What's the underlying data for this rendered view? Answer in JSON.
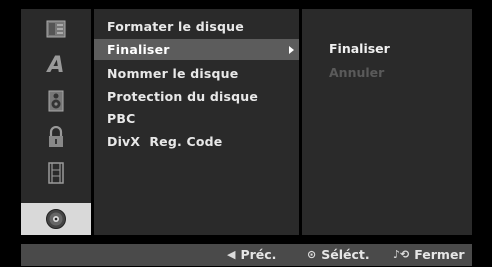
{
  "sidebar": {
    "icons": [
      {
        "name": "disc-menu-icon"
      },
      {
        "name": "language-icon",
        "glyph": "A"
      },
      {
        "name": "audio-speaker-icon"
      },
      {
        "name": "lock-icon"
      },
      {
        "name": "film-record-icon"
      },
      {
        "name": "disc-settings-icon",
        "active": true
      }
    ]
  },
  "menu": {
    "items": [
      {
        "label": "Formater le disque"
      },
      {
        "label": "Finaliser",
        "selected": true
      },
      {
        "label": "Nommer le disque"
      },
      {
        "label": "Protection du disque"
      },
      {
        "label": "PBC"
      },
      {
        "label": "DivX  Reg. Code"
      }
    ]
  },
  "submenu": {
    "items": [
      {
        "label": "Finaliser",
        "enabled": true
      },
      {
        "label": "Annuler",
        "enabled": false
      }
    ]
  },
  "navbar": {
    "prev": {
      "glyph": "◀",
      "label": "Préc."
    },
    "select": {
      "glyph": "⊙",
      "label": "Séléct."
    },
    "close": {
      "glyph": "♪⟲",
      "label": "Fermer"
    }
  },
  "colors": {
    "panel_bg": "#2a2a2a",
    "selected_bg": "#5c5c5c",
    "active_icon_bg": "#d9d9d9",
    "navbar_bg": "#4a4a4a",
    "disabled_text": "#5a5a5a"
  }
}
